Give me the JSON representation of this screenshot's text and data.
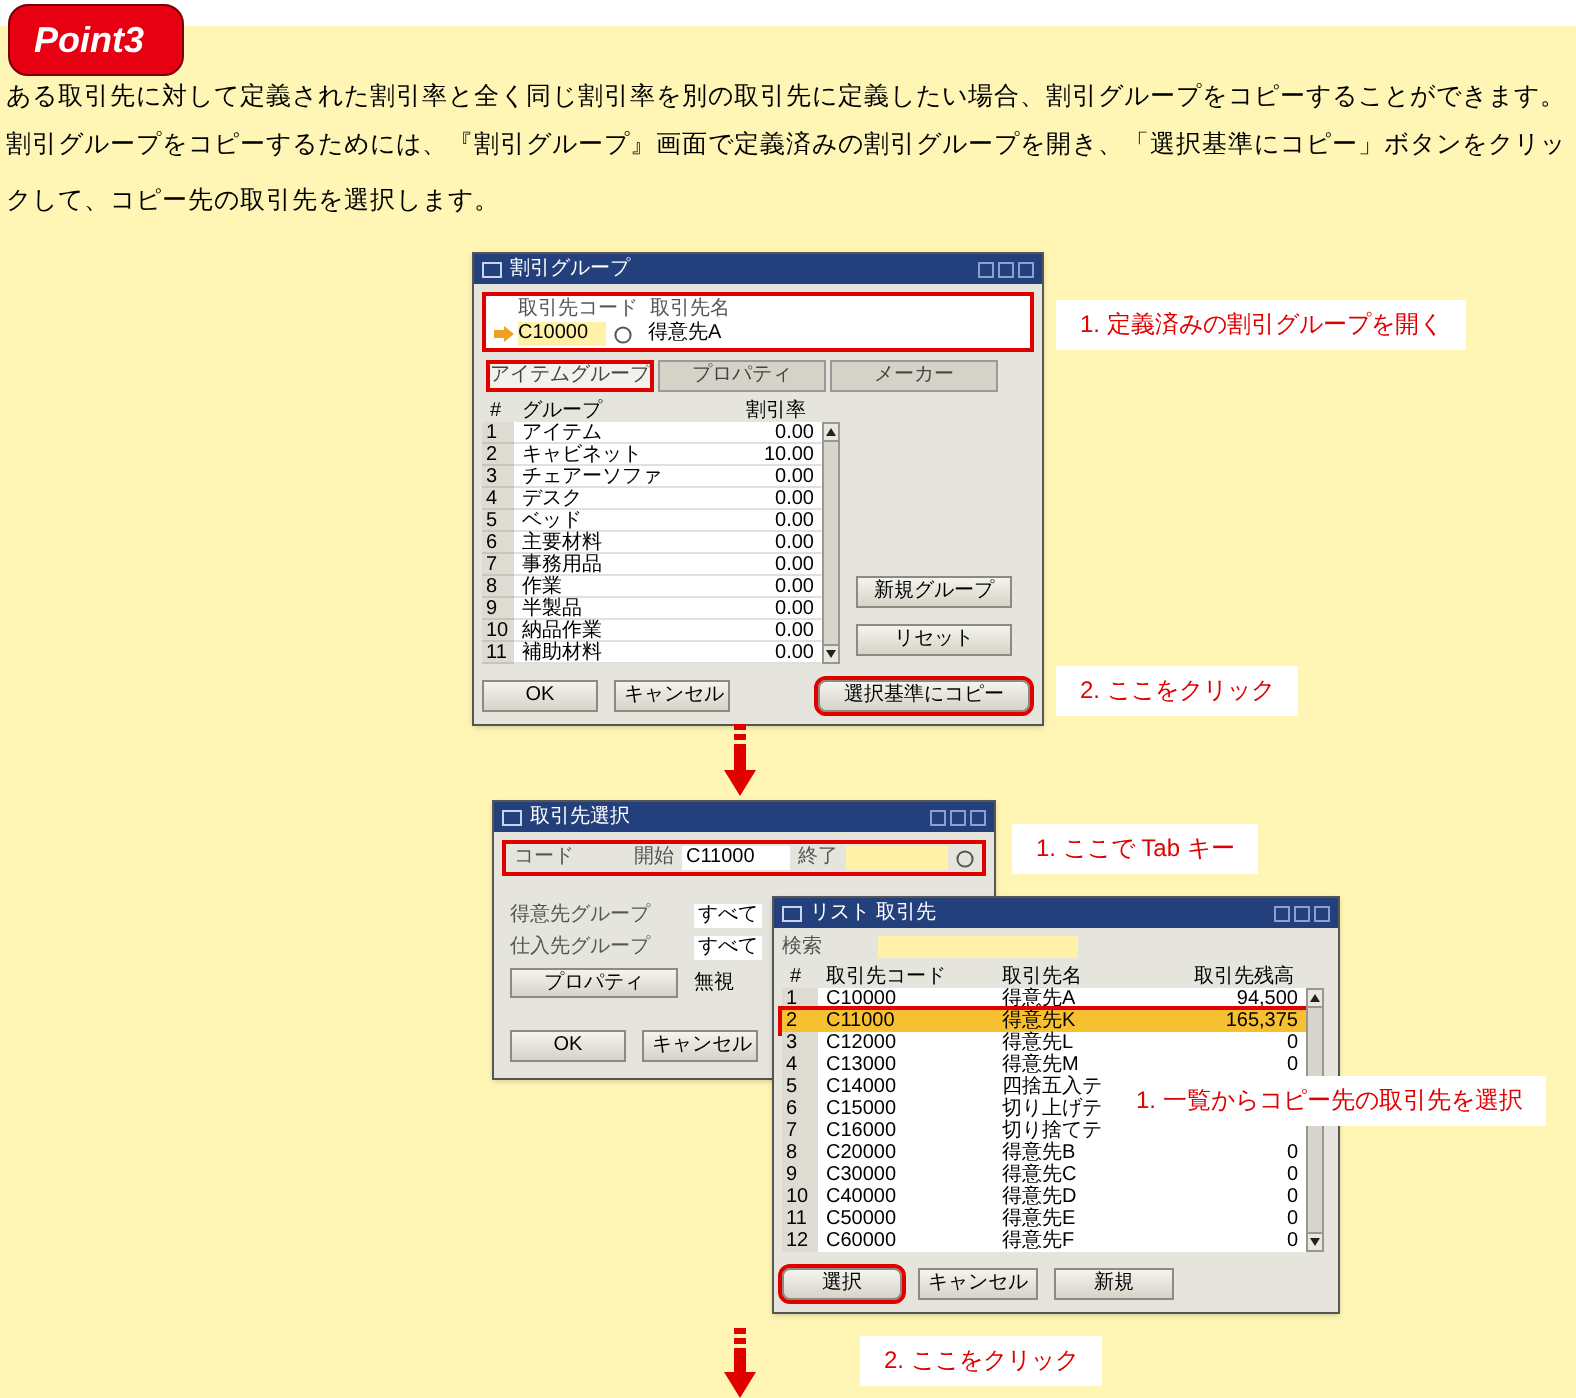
{
  "badge": "Point3",
  "intro": [
    "ある取引先に対して定義された割引率と全く同じ割引率を別の取引先に定義したい場合、割引グループをコピーすることができます。",
    "割引グループをコピーするためには、『割引グループ』画面で定義済みの割引グループを開き、「選択基準にコピー」ボタンをクリックして、コピー先の取引先を選択します。"
  ],
  "discount_window": {
    "title": "割引グループ",
    "code_label": "取引先コード",
    "code": "C10000",
    "name_label": "取引先名",
    "name": "得意先A",
    "header_highlighted": true,
    "tabs": [
      {
        "label": "アイテムグループ",
        "selected": true
      },
      {
        "label": "プロパティ",
        "selected": false
      },
      {
        "label": "メーカー",
        "selected": false
      }
    ],
    "columns": [
      "#",
      "グループ",
      "割引率"
    ],
    "rows": [
      {
        "no": "1",
        "group": "アイテム",
        "rate": "0.00"
      },
      {
        "no": "2",
        "group": "キャビネット",
        "rate": "10.00"
      },
      {
        "no": "3",
        "group": "チェアーソファ",
        "rate": "0.00"
      },
      {
        "no": "4",
        "group": "デスク",
        "rate": "0.00"
      },
      {
        "no": "5",
        "group": "ベッド",
        "rate": "0.00"
      },
      {
        "no": "6",
        "group": "主要材料",
        "rate": "0.00"
      },
      {
        "no": "7",
        "group": "事務用品",
        "rate": "0.00"
      },
      {
        "no": "8",
        "group": "作業",
        "rate": "0.00"
      },
      {
        "no": "9",
        "group": "半製品",
        "rate": "0.00"
      },
      {
        "no": "10",
        "group": "納品作業",
        "rate": "0.00"
      },
      {
        "no": "11",
        "group": "補助材料",
        "rate": "0.00"
      }
    ],
    "side_buttons": [
      "新規グループ",
      "リセット"
    ],
    "buttons": [
      {
        "label": "OK",
        "highlighted": false
      },
      {
        "label": "キャンセル",
        "highlighted": false
      }
    ],
    "copy_button": {
      "label": "選択基準にコピー",
      "highlighted": true
    }
  },
  "callout_open": "1. 定義済みの割引グループを開く",
  "callout_click": "2. ここをクリック",
  "selection_window": {
    "title": "取引先選択",
    "code_label": "コード",
    "from_label": "開始",
    "from": "C11000",
    "to_label": "終了",
    "code_highlighted": true,
    "groups": [
      {
        "label": "得意先グループ",
        "value": "すべて"
      },
      {
        "label": "仕入先グループ",
        "value": "すべて"
      }
    ],
    "properties_button": "プロパティ",
    "properties_value": "無視",
    "buttons": [
      {
        "label": "OK",
        "highlighted": false
      },
      {
        "label": "キャンセル",
        "highlighted": false
      }
    ]
  },
  "callout_tab": "1. ここで Tab キー",
  "list_window": {
    "title": "リスト 取引先",
    "search_label": "検索",
    "columns": [
      "#",
      "取引先コード",
      "取引先名",
      "取引先残高"
    ],
    "rows": [
      {
        "no": "1",
        "code": "C10000",
        "name": "得意先A",
        "balance": "94,500",
        "selected": false
      },
      {
        "no": "2",
        "code": "C11000",
        "name": "得意先K",
        "balance": "165,375",
        "selected": true
      },
      {
        "no": "3",
        "code": "C12000",
        "name": "得意先L",
        "balance": "0",
        "selected": false
      },
      {
        "no": "4",
        "code": "C13000",
        "name": "得意先M",
        "balance": "0",
        "selected": false
      },
      {
        "no": "5",
        "code": "C14000",
        "name": "四捨五入テ",
        "selected": false
      },
      {
        "no": "6",
        "code": "C15000",
        "name": "切り上げテ",
        "selected": false
      },
      {
        "no": "7",
        "code": "C16000",
        "name": "切り捨てテ",
        "selected": false
      },
      {
        "no": "8",
        "code": "C20000",
        "name": "得意先B",
        "balance": "0",
        "selected": false
      },
      {
        "no": "9",
        "code": "C30000",
        "name": "得意先C",
        "balance": "0",
        "selected": false
      },
      {
        "no": "10",
        "code": "C40000",
        "name": "得意先D",
        "balance": "0",
        "selected": false
      },
      {
        "no": "11",
        "code": "C50000",
        "name": "得意先E",
        "balance": "0",
        "selected": false
      },
      {
        "no": "12",
        "code": "C60000",
        "name": "得意先F",
        "balance": "0",
        "selected": false
      }
    ],
    "buttons": [
      {
        "label": "選択",
        "highlighted": true
      },
      {
        "label": "キャンセル",
        "highlighted": false
      },
      {
        "label": "新規",
        "highlighted": false
      }
    ]
  },
  "callout_choose": "1. 一覧からコピー先の取引先を選択",
  "callout_click2": "2. ここをクリック"
}
